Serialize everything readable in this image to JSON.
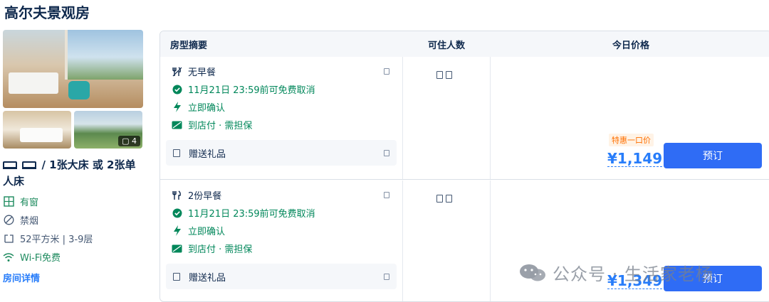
{
  "room": {
    "title": "高尔夫景观房",
    "photo_count": "4",
    "bed_desc": "/ 1张大床 或 2张单人床",
    "features": [
      {
        "icon": "window-icon",
        "label": "有窗"
      },
      {
        "icon": "no-smoking-icon",
        "label": "禁烟"
      },
      {
        "icon": "area-icon",
        "label": "52平方米 | 3-9层"
      },
      {
        "icon": "wifi-icon",
        "label": "Wi-Fi免费"
      }
    ],
    "details_link": "房间详情"
  },
  "table": {
    "headers": {
      "summary": "房型摘要",
      "guests": "可住人数",
      "price": "今日价格"
    },
    "rows": [
      {
        "meal": "无早餐",
        "cancel": "11月21日 23:59前可免费取消",
        "confirm": "立即确认",
        "payment": "到店付 · 需担保",
        "gift": "赠送礼品",
        "deal_tag": "特惠一口价",
        "price": "¥1,149",
        "book": "预订"
      },
      {
        "meal": "2份早餐",
        "cancel": "11月21日 23:59前可免费取消",
        "confirm": "立即确认",
        "payment": "到店付 · 需担保",
        "gift": "赠送礼品",
        "deal_tag": "",
        "price": "¥1,349",
        "book": "预订"
      }
    ]
  },
  "watermark": "公众号 · 生活家老杨",
  "colors": {
    "accent": "#287dfa",
    "button": "#2f6cf5",
    "green": "#00875a",
    "deal": "#ff6f00"
  }
}
